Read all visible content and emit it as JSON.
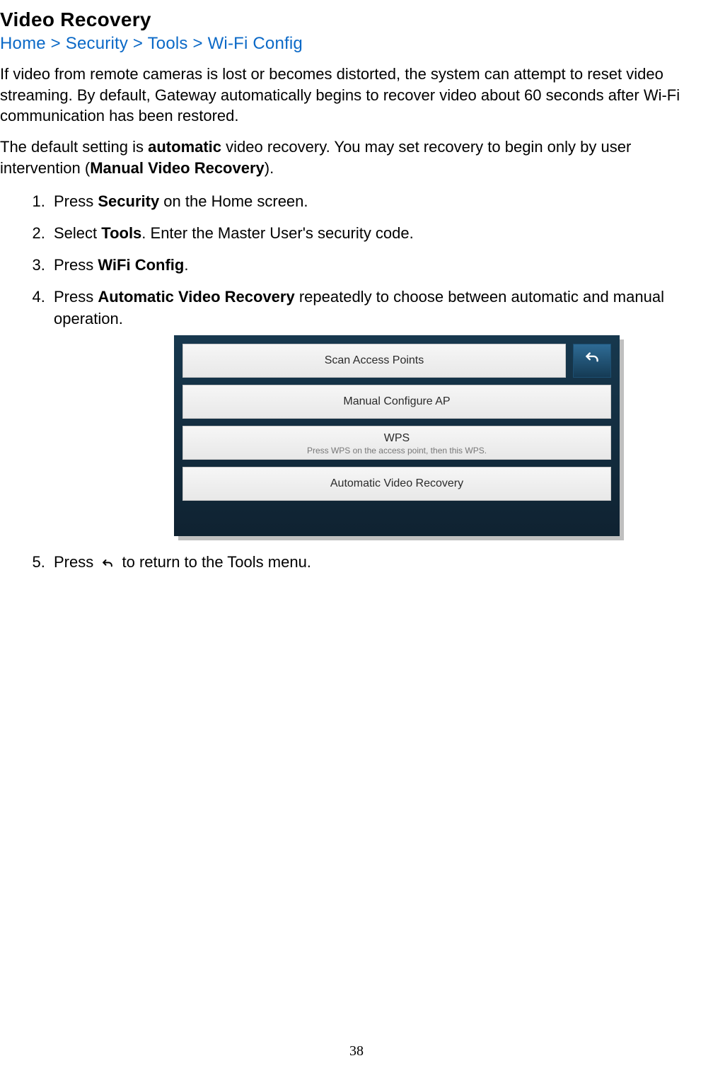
{
  "title": "Video Recovery",
  "breadcrumb": "Home > Security > Tools > Wi-Fi Config",
  "intro": "If video from remote cameras is lost or becomes distorted, the system can attempt to reset video streaming.  By default, Gateway automatically begins to recover video about 60 seconds after Wi-Fi communication has been restored.",
  "default_pre": "The default setting is ",
  "default_bold1": "automatic",
  "default_mid": " video recovery. You may set recovery to begin only by user intervention (",
  "default_bold2": "Manual Video Recovery",
  "default_post": ").",
  "steps": {
    "s1_pre": "Press ",
    "s1_b": "Security",
    "s1_post": " on the Home screen.",
    "s2_pre": "Select ",
    "s2_b": "Tools",
    "s2_post": ". Enter the Master User's security code.",
    "s3_pre": "Press ",
    "s3_b": "WiFi Config",
    "s3_post": ".",
    "s4_pre": "Press ",
    "s4_b": "Automatic Video Recovery",
    "s4_post": " repeatedly to choose between automatic and manual operation.",
    "s5_pre": "Press",
    "s5_post": "to return to the Tools menu."
  },
  "device_menu": {
    "scan": "Scan Access Points",
    "manual_ap": "Manual Configure AP",
    "wps": "WPS",
    "wps_sub": "Press WPS on the access point, then this WPS.",
    "auto_recovery": "Automatic Video Recovery"
  },
  "page_number": "38"
}
